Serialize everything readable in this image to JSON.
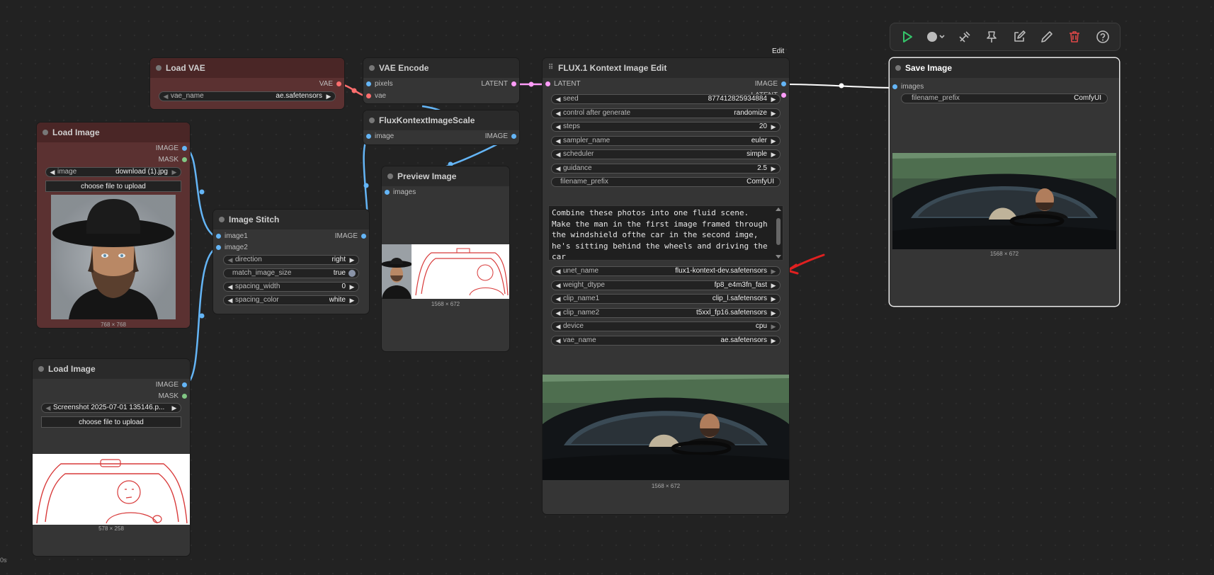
{
  "toolbar": {
    "run_icon": "play-icon",
    "colors": {
      "run": "#35c46a",
      "delete": "#e04848"
    }
  },
  "edit_label": "Edit",
  "corner_label": "0s",
  "load_vae": {
    "title": "Load VAE",
    "out_vae": "VAE",
    "vae_name": {
      "label": "vae_name",
      "value": "ae.safetensors"
    }
  },
  "vae_encode": {
    "title": "VAE Encode",
    "in_pixels": "pixels",
    "in_vae": "vae",
    "out_latent": "LATENT"
  },
  "flux_scale": {
    "title": "FluxKontextImageScale",
    "in_image": "image",
    "out_image": "IMAGE"
  },
  "load_image_1": {
    "title": "Load Image",
    "out_image": "IMAGE",
    "out_mask": "MASK",
    "image": {
      "label": "image",
      "value": "download (1).jpg"
    },
    "upload": "choose file to upload",
    "dims": "768 × 768"
  },
  "load_image_2": {
    "title": "Load Image",
    "out_image": "IMAGE",
    "out_mask": "MASK",
    "image": {
      "value": "Screenshot 2025-07-01 135146.p..."
    },
    "upload": "choose file to upload",
    "dims": "578 × 258"
  },
  "image_stitch": {
    "title": "Image Stitch",
    "in_image1": "image1",
    "in_image2": "image2",
    "out_image": "IMAGE",
    "direction": {
      "label": "direction",
      "value": "right"
    },
    "match_image_size": {
      "label": "match_image_size",
      "value": "true"
    },
    "spacing_width": {
      "label": "spacing_width",
      "value": "0"
    },
    "spacing_color": {
      "label": "spacing_color",
      "value": "white"
    }
  },
  "preview_image": {
    "title": "Preview Image",
    "in_images": "images",
    "dims": "1568 × 672"
  },
  "flux_edit": {
    "title": "FLUX.1 Kontext Image Edit",
    "in_latent": "LATENT",
    "out_image": "IMAGE",
    "out_latent": "LATENT",
    "widgets": [
      {
        "label": "seed",
        "value": "877412825934884"
      },
      {
        "label": "control after generate",
        "value": "randomize"
      },
      {
        "label": "steps",
        "value": "20"
      },
      {
        "label": "sampler_name",
        "value": "euler"
      },
      {
        "label": "scheduler",
        "value": "simple"
      },
      {
        "label": "guidance",
        "value": "2.5"
      },
      {
        "label": "filename_prefix",
        "value": "ComfyUI"
      }
    ],
    "prompt": "Combine these photos into one fluid scene. Make the man in the first image framed through the windshield ofthe car in the second imge, he's sitting behind the wheels and driving the car",
    "widgets2": [
      {
        "label": "unet_name",
        "value": "flux1-kontext-dev.safetensors"
      },
      {
        "label": "weight_dtype",
        "value": "fp8_e4m3fn_fast"
      },
      {
        "label": "clip_name1",
        "value": "clip_l.safetensors"
      },
      {
        "label": "clip_name2",
        "value": "t5xxl_fp16.safetensors"
      },
      {
        "label": "device",
        "value": "cpu"
      },
      {
        "label": "vae_name",
        "value": "ae.safetensors"
      }
    ],
    "dims": "1568 × 672"
  },
  "save_image": {
    "title": "Save Image",
    "in_images": "images",
    "filename_prefix": {
      "label": "filename_prefix",
      "value": "ComfyUI"
    },
    "dims": "1568 × 672"
  }
}
